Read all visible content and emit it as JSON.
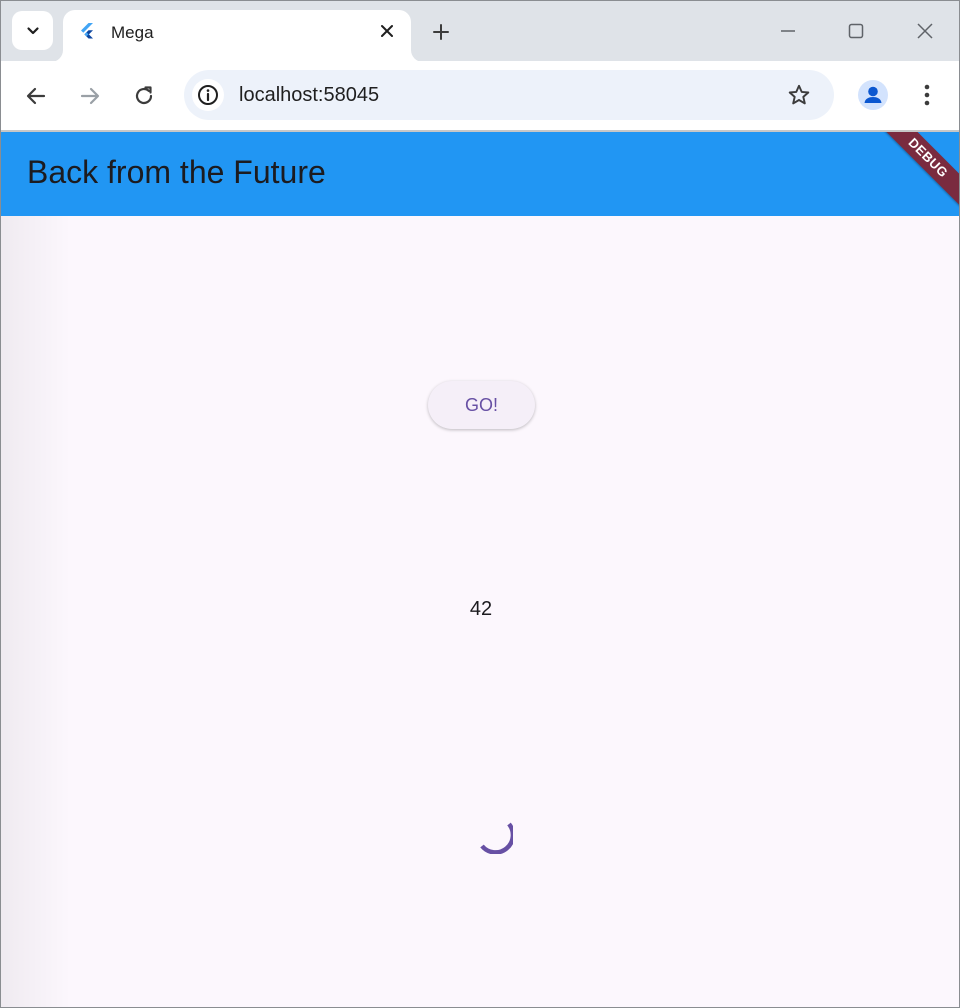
{
  "browser": {
    "tab": {
      "title": "Mega",
      "favicon": "flutter-logo-icon"
    },
    "url": "localhost:58045",
    "icons": {
      "tab_search": "chevron-down-icon",
      "tab_close": "close-icon",
      "new_tab": "plus-icon",
      "minimize": "minimize-icon",
      "maximize": "maximize-icon",
      "close": "close-icon",
      "back": "arrow-left-icon",
      "forward": "arrow-right-icon",
      "reload": "reload-icon",
      "site_info": "info-icon",
      "bookmark": "star-icon",
      "profile": "person-icon",
      "menu": "more-vertical-icon"
    }
  },
  "app": {
    "title": "Back from the Future",
    "debug_banner": "DEBUG",
    "button_label": "GO!",
    "result": "42",
    "colors": {
      "appbar": "#2196f3",
      "background": "#fcf7fd",
      "button_text": "#6750a4",
      "spinner": "#6750a4",
      "debug_banner": "#7a2b3f"
    }
  }
}
